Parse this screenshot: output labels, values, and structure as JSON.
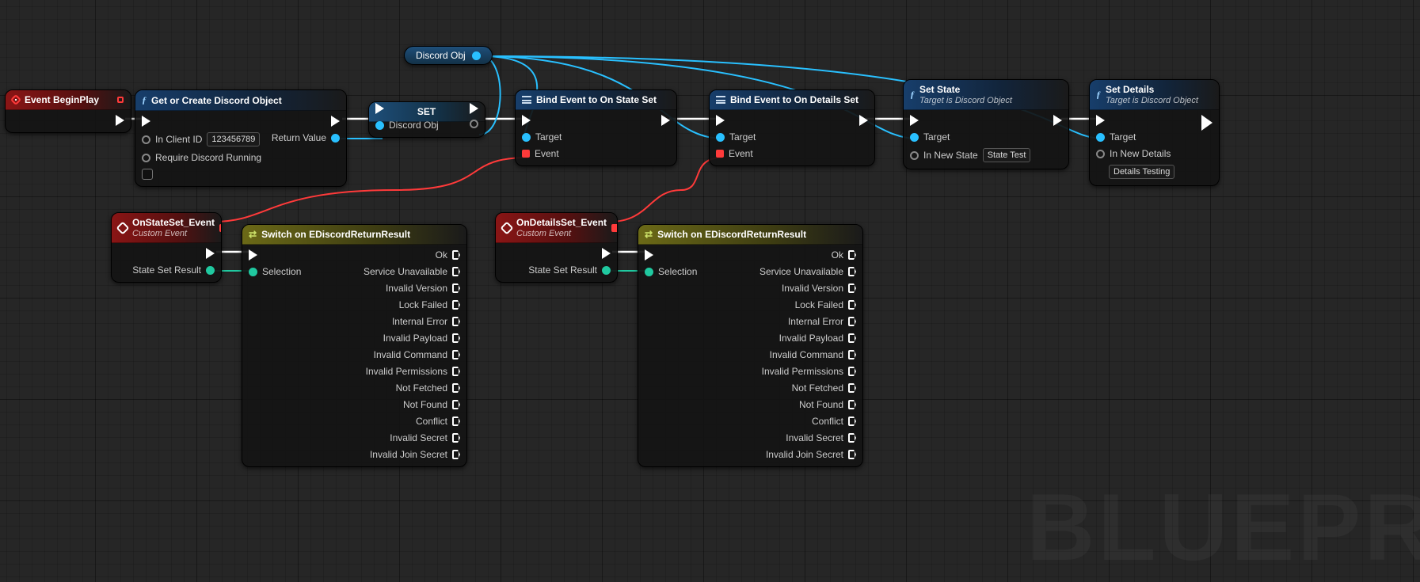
{
  "watermark": "BLUEPR",
  "var_pill": {
    "label": "Discord Obj"
  },
  "nodes": {
    "beginplay": {
      "title": "Event BeginPlay"
    },
    "getcreate": {
      "title": "Get or Create Discord Object",
      "in_clientid_label": "In Client ID",
      "in_clientid_value": "123456789",
      "require_label": "Require Discord Running",
      "return_label": "Return Value"
    },
    "set": {
      "title": "SET",
      "var_label": "Discord Obj"
    },
    "bind_state": {
      "title": "Bind Event to On State Set",
      "target": "Target",
      "event": "Event"
    },
    "bind_details": {
      "title": "Bind Event to On Details Set",
      "target": "Target",
      "event": "Event"
    },
    "setstate": {
      "title": "Set State",
      "subtitle": "Target is Discord Object",
      "target": "Target",
      "param_label": "In New State",
      "param_value": "State Test"
    },
    "setdetails": {
      "title": "Set Details",
      "subtitle": "Target is Discord Object",
      "target": "Target",
      "param_label": "In New Details",
      "param_value": "Details Testing"
    },
    "onstate": {
      "title": "OnStateSet_Event",
      "subtitle": "Custom Event",
      "result": "State Set Result"
    },
    "ondetails": {
      "title": "OnDetailsSet_Event",
      "subtitle": "Custom Event",
      "result": "State Set Result"
    },
    "switch": {
      "title": "Switch on EDiscordReturnResult",
      "sel": "Selection",
      "cases": [
        "Ok",
        "Service Unavailable",
        "Invalid Version",
        "Lock Failed",
        "Internal Error",
        "Invalid Payload",
        "Invalid Command",
        "Invalid Permissions",
        "Not Fetched",
        "Not Found",
        "Conflict",
        "Invalid Secret",
        "Invalid Join Secret"
      ]
    }
  }
}
